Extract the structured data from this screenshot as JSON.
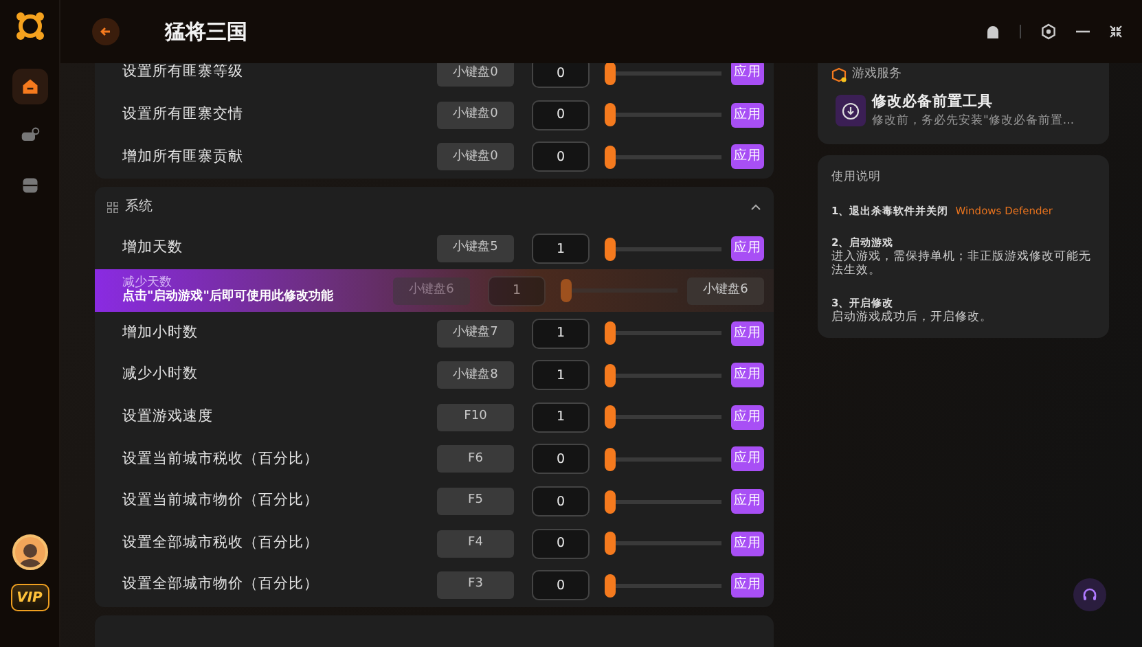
{
  "app": {
    "title": "猛将三国"
  },
  "sidebar": {
    "items": [
      {
        "kind": "home",
        "selected": true
      },
      {
        "kind": "games",
        "selected": false
      },
      {
        "kind": "box",
        "selected": false
      }
    ],
    "vip": "VIP"
  },
  "sections": [
    {
      "rows": [
        {
          "kind": "normal",
          "label": "设置所有匪寨等级",
          "hotkey": "小键盘0",
          "value": "0",
          "level": 0,
          "apply": "应用"
        },
        {
          "kind": "normal",
          "label": "设置所有匪寨交情",
          "hotkey": "小键盘0",
          "value": "0",
          "level": 0,
          "apply": "应用"
        },
        {
          "kind": "normal",
          "label": "增加所有匪寨贡献",
          "hotkey": "小键盘0",
          "value": "0",
          "level": 0,
          "apply": "应用"
        }
      ]
    },
    {
      "title": "系统",
      "expanded": true,
      "rows": [
        {
          "kind": "normal",
          "label": "增加天数",
          "hotkey": "小键盘5",
          "value": "1",
          "level": 0,
          "apply": "应用"
        },
        {
          "kind": "locked",
          "label": "减少天数",
          "note": "点击\"启动游戏\"后即可使用此修改功能",
          "hotkey": "小键盘6",
          "value": "1",
          "level": 0,
          "button": "小键盘6"
        },
        {
          "kind": "normal",
          "label": "增加小时数",
          "hotkey": "小键盘7",
          "value": "1",
          "level": 0,
          "apply": "应用"
        },
        {
          "kind": "normal",
          "label": "减少小时数",
          "hotkey": "小键盘8",
          "value": "1",
          "level": 0,
          "apply": "应用"
        },
        {
          "kind": "normal",
          "label": "设置游戏速度",
          "hotkey": "F10",
          "value": "1",
          "level": 0,
          "apply": "应用"
        },
        {
          "kind": "normal",
          "label": "设置当前城市税收（百分比）",
          "hotkey": "F6",
          "value": "0",
          "level": 0,
          "apply": "应用"
        },
        {
          "kind": "normal",
          "label": "设置当前城市物价（百分比）",
          "hotkey": "F5",
          "value": "0",
          "level": 0,
          "apply": "应用"
        },
        {
          "kind": "normal",
          "label": "设置全部城市税收（百分比）",
          "hotkey": "F4",
          "value": "0",
          "level": 0,
          "apply": "应用"
        },
        {
          "kind": "normal",
          "label": "设置全部城市物价（百分比）",
          "hotkey": "F3",
          "value": "0",
          "level": 0,
          "apply": "应用"
        }
      ]
    }
  ],
  "service": {
    "heading": "游戏服务",
    "tool_title": "修改必备前置工具",
    "tool_desc": "修改前，务必先安装\"修改必备前置..."
  },
  "instructions": {
    "heading": "使用说明",
    "steps": [
      {
        "title": "1、退出杀毒软件并关闭",
        "link": "Windows Defender"
      },
      {
        "title": "2、启动游戏",
        "body": "进入游戏，需保持单机；非正版游戏修改可能无法生效。"
      },
      {
        "title": "3、开启修改",
        "body": "启动游戏成功后，开启修改。"
      }
    ]
  }
}
